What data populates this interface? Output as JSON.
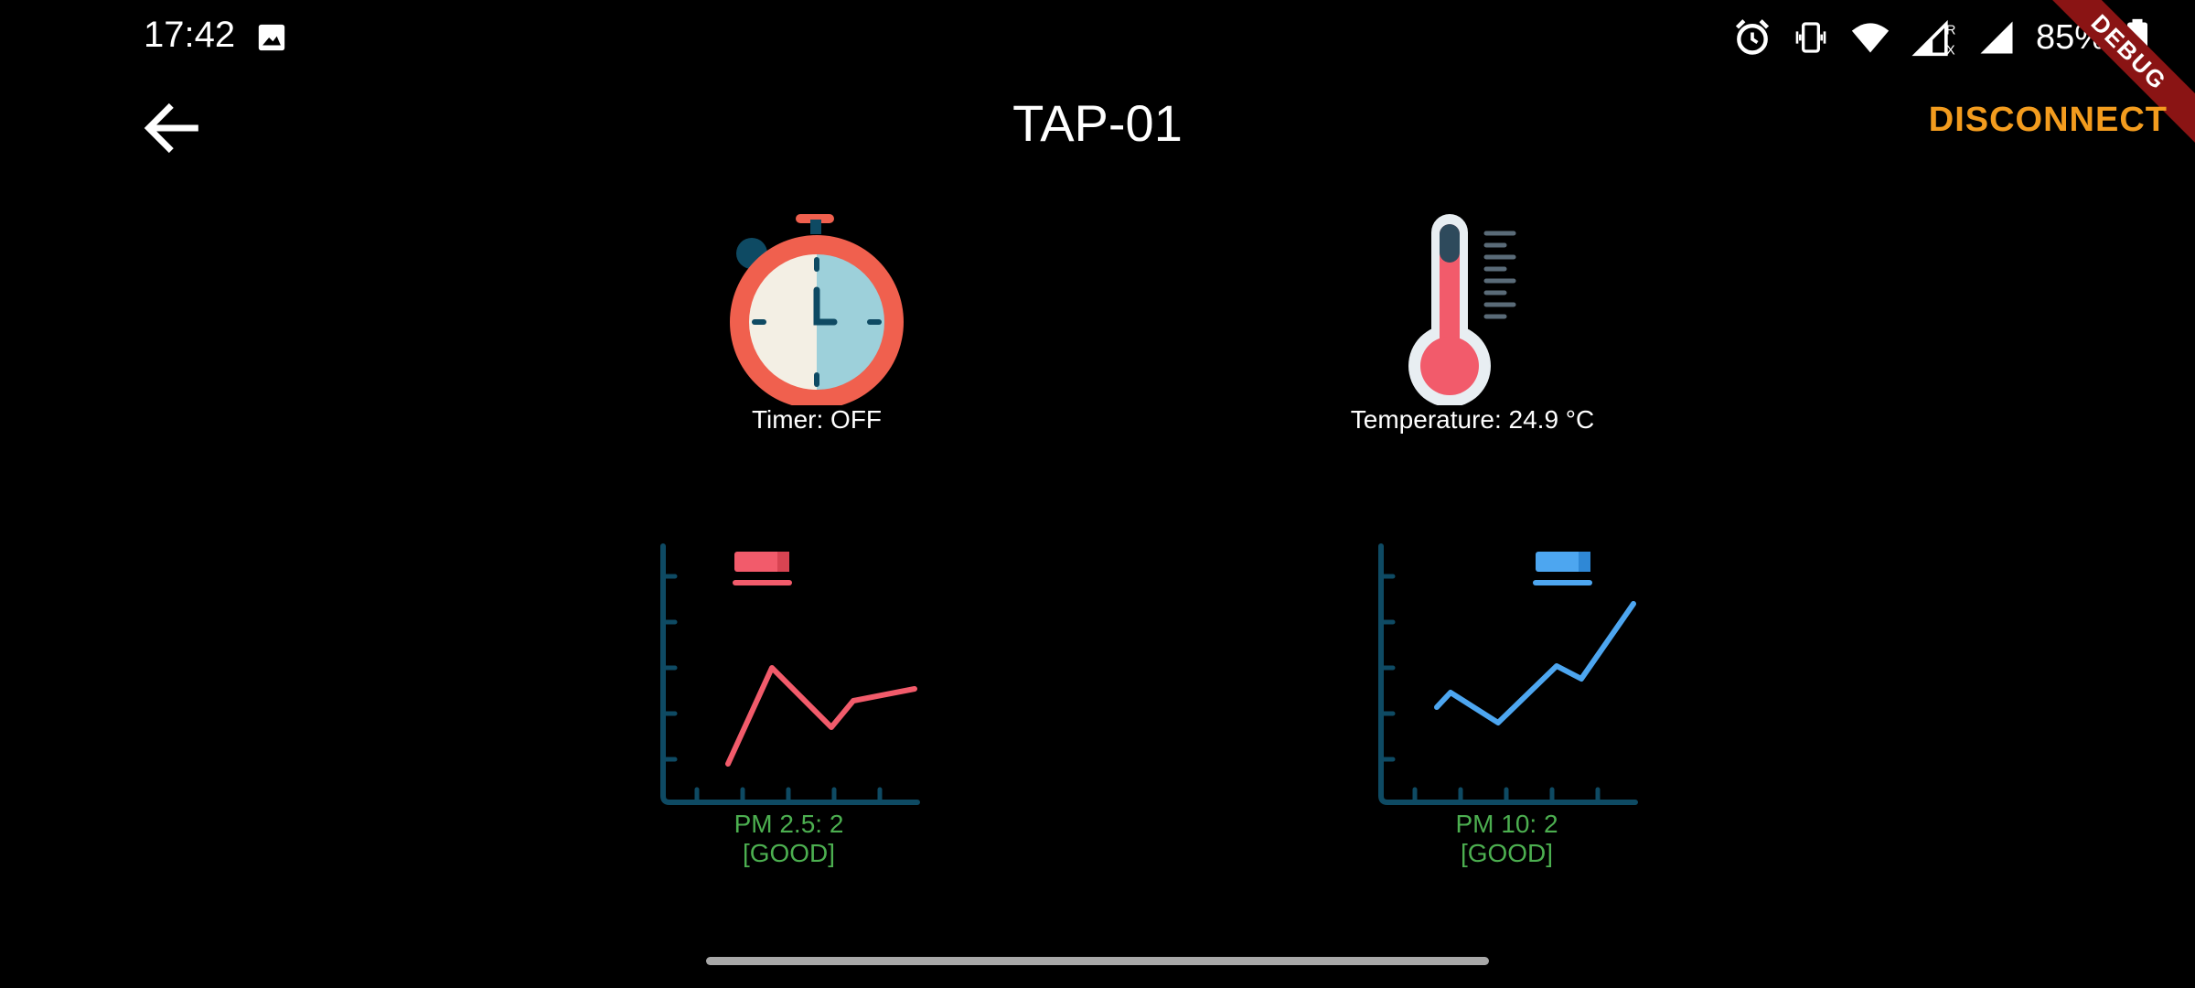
{
  "status_bar": {
    "time": "17:42",
    "battery": "85%",
    "icons": [
      "image-icon",
      "alarm-icon",
      "vibrate-icon",
      "wifi-icon",
      "signal-roaming-icon",
      "signal-icon",
      "battery-icon"
    ]
  },
  "debug_banner": "DEBUG",
  "app_bar": {
    "title": "TAP-01",
    "disconnect_label": "DISCONNECT",
    "back_icon": "arrow-left-icon"
  },
  "tiles": {
    "timer": {
      "icon": "stopwatch-icon",
      "label": "Timer: OFF"
    },
    "temperature": {
      "icon": "thermometer-icon",
      "label": "Temperature: 24.9 °C"
    },
    "pm25": {
      "icon": "line-chart-red-icon",
      "value_label": "PM 2.5: 2",
      "quality_label": "[GOOD]"
    },
    "pm10": {
      "icon": "line-chart-blue-icon",
      "value_label": "PM 10: 2",
      "quality_label": "[GOOD]"
    }
  },
  "colors": {
    "accent": "#f39c1e",
    "good": "#4caf50",
    "background": "#000000",
    "chart_red": "#f25b6b",
    "chart_blue": "#4da6f0",
    "chart_axis": "#0e4a63"
  }
}
